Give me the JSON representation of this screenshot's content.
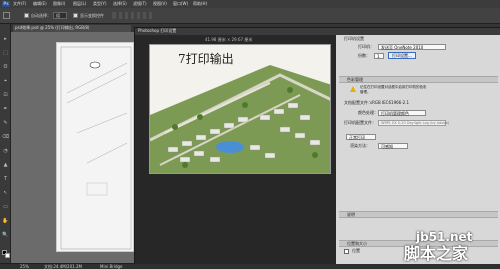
{
  "app": {
    "logo": "Ps",
    "menu": [
      "文件(F)",
      "编辑(E)",
      "图像(I)",
      "图层(L)",
      "类型(Y)",
      "选择(S)",
      "滤镜(T)",
      "视图(V)",
      "窗口(W)",
      "帮助(H)"
    ],
    "options": {
      "auto_select_label": "自动选择：",
      "auto_select_value": "组",
      "show_transform_label": "显示变换控件"
    },
    "doc_tab": "psd效果.psd @ 25% (打印输出, RGB/8)",
    "zoom": "25%",
    "doc_size": "文档:24.4M/201.2M",
    "mini_bridge": "Mini Bridge",
    "tools": [
      "▸",
      "⬚",
      "ʘ",
      "⌖",
      "⊡",
      "✒",
      "✎",
      "⌫",
      "◔",
      "▲",
      "T",
      "↖",
      "▭",
      "✋",
      "🔍"
    ]
  },
  "dialog": {
    "title": "Photoshop 打印设置",
    "preview": {
      "dimension": "41.98 厘米 × 29.67 厘米",
      "image_title": "7打印输出"
    },
    "settings": {
      "printer_section": "打印机设置",
      "printer_label": "打印机：",
      "printer_value": "发送至 OneNote 2010",
      "copies_label": "份数：",
      "copies_value": "1",
      "print_settings_button": "打印设置...",
      "color_section": "色彩管理",
      "color_note": "记住在打印设置对话框中启用打印机的色彩管理。",
      "doc_profile_label": "文档配置文件：",
      "doc_profile_value": "sRGB IEC61966-2.1",
      "color_handling_label": "颜色处理：",
      "color_handling_value": "打印机管理颜色",
      "printer_profile_label": "打印机配置文件：",
      "printer_profile_value": "WRPL EX 0-20 Daylight Log (by Adobe)",
      "normal_print_value": "正常打印",
      "intent_label": "渲染方法：",
      "intent_value": "可感知",
      "description_section": "说明",
      "position_section": "位置和大小",
      "position_label": "位置"
    }
  },
  "watermark": {
    "site": "jb51.net",
    "brand": "脚本之家"
  },
  "colors": {
    "accent": "#3a6bc4",
    "dialog_bg": "#d8d8d8",
    "preview_bg": "#272727",
    "menubar": "#3c3c3c"
  }
}
